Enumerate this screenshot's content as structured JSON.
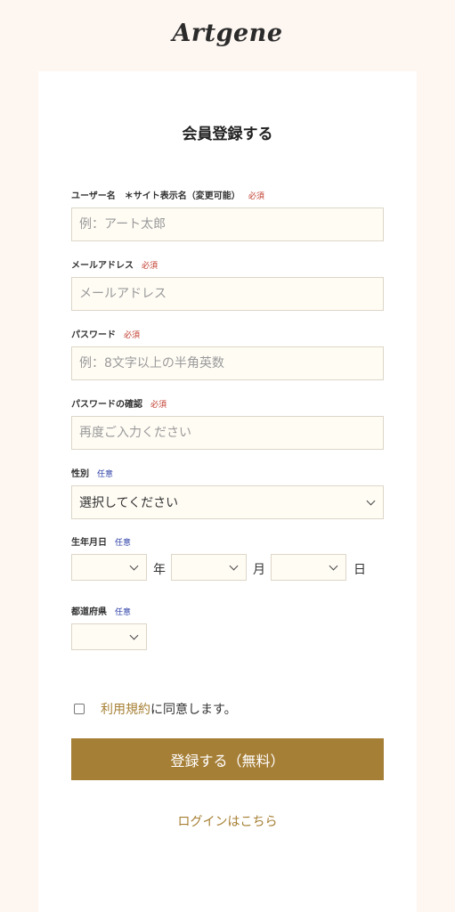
{
  "header": {
    "logo": "Artgene"
  },
  "form": {
    "title": "会員登録する",
    "required_tag": "必須",
    "optional_tag": "任意",
    "username": {
      "label": "ユーザー名　＊サイト表示名（変更可能）",
      "placeholder": "例：アート太郎"
    },
    "email": {
      "label": "メールアドレス",
      "placeholder": "メールアドレス"
    },
    "password": {
      "label": "パスワード",
      "placeholder": "例：8文字以上の半角英数"
    },
    "password_confirm": {
      "label": "パスワードの確認",
      "placeholder": "再度ご入力ください"
    },
    "gender": {
      "label": "性別",
      "selected": "選択してください"
    },
    "birthday": {
      "label": "生年月日",
      "year_unit": "年",
      "month_unit": "月",
      "day_unit": "日"
    },
    "prefecture": {
      "label": "都道府県"
    },
    "agree": {
      "terms_link": "利用規約",
      "suffix": "に同意します。"
    },
    "submit_label": "登録する（無料）",
    "login_link": "ログインはこちら"
  },
  "colors": {
    "background": "#fdf6f1",
    "accent": "#a67f37",
    "required": "#c0392b",
    "optional": "#2b3ea6",
    "field_bg": "#fffcf4"
  }
}
